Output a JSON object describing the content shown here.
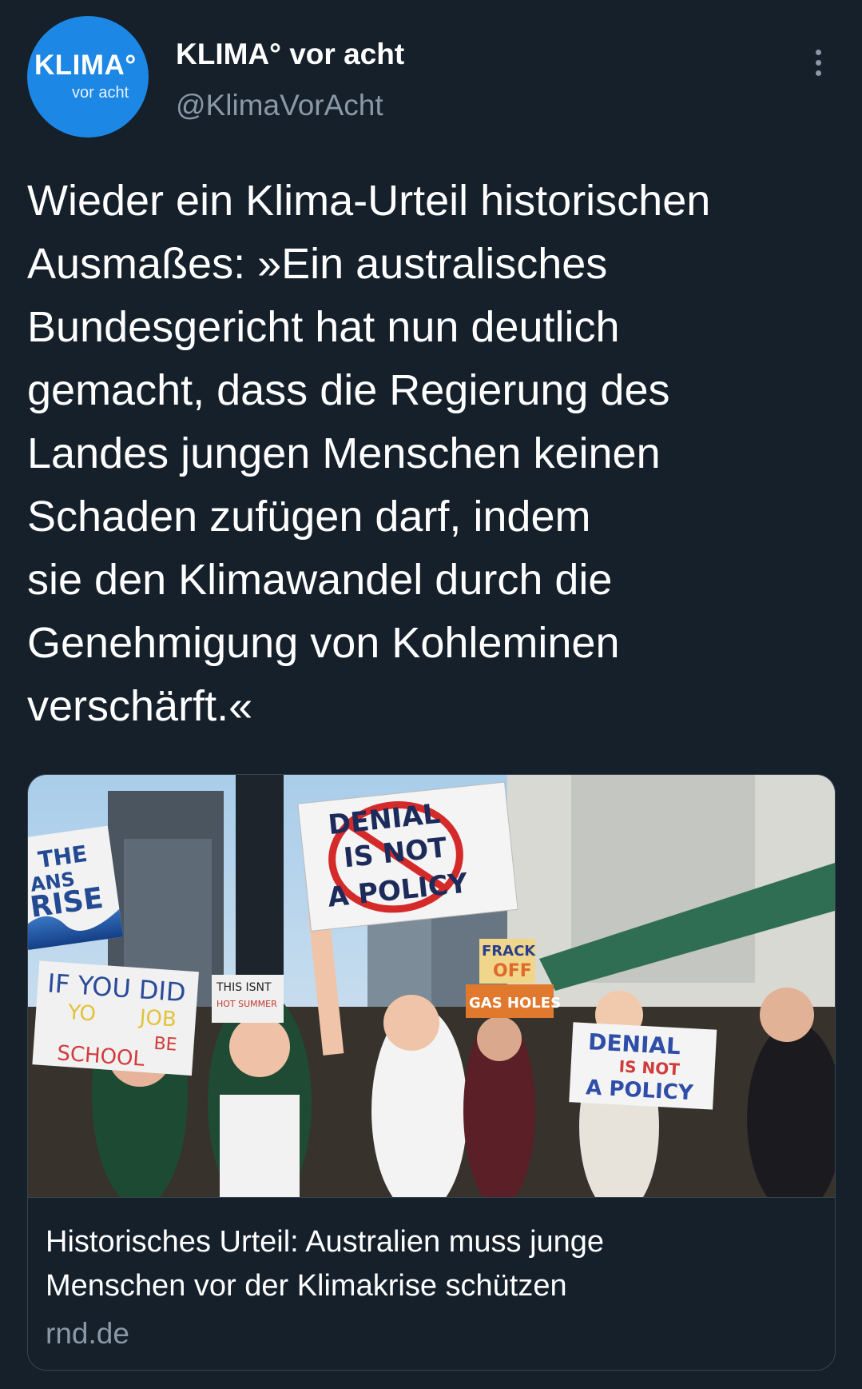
{
  "account": {
    "avatar_title": "KLIMA°",
    "avatar_subtitle": "vor acht",
    "display_name": "KLIMA° vor acht",
    "handle": "@KlimaVorAcht"
  },
  "tweet": {
    "text": "Wieder ein Klima-Urteil historischen\nAusmaßes: »Ein australisches\nBundesgericht hat nun deutlich\ngemacht, dass die Regierung des\nLandes jungen Menschen keinen\nSchaden zufügen darf, indem\nsie den Klimawandel durch die\nGenehmigung von Kohleminen\nverschärft.«"
  },
  "card": {
    "title": "Historisches Urteil: Australien muss junge\nMenschen vor der Klimakrise schützen",
    "domain": "rnd.de",
    "image_signs": {
      "sign_main": [
        "DENIAL",
        "IS NOT",
        "A POLICY"
      ],
      "sign_left": [
        "THE",
        "ANS",
        "RISE"
      ],
      "sign_bottom_left": [
        "IF YOU DID",
        "YO",
        "JOB",
        "BE",
        "SCHOOL"
      ],
      "sign_small": [
        "THIS ISNT",
        "HOT SUMMER"
      ],
      "sign_frack": [
        "FRACK",
        "OFF"
      ],
      "sign_gas": "GAS HOLES",
      "sign_right": [
        "DENIAL",
        "IS NOT",
        "A POLICY"
      ]
    }
  },
  "colors": {
    "background": "#15202b",
    "avatar": "#1d87e5",
    "secondary_text": "#8b98a5",
    "border": "#38444d"
  }
}
